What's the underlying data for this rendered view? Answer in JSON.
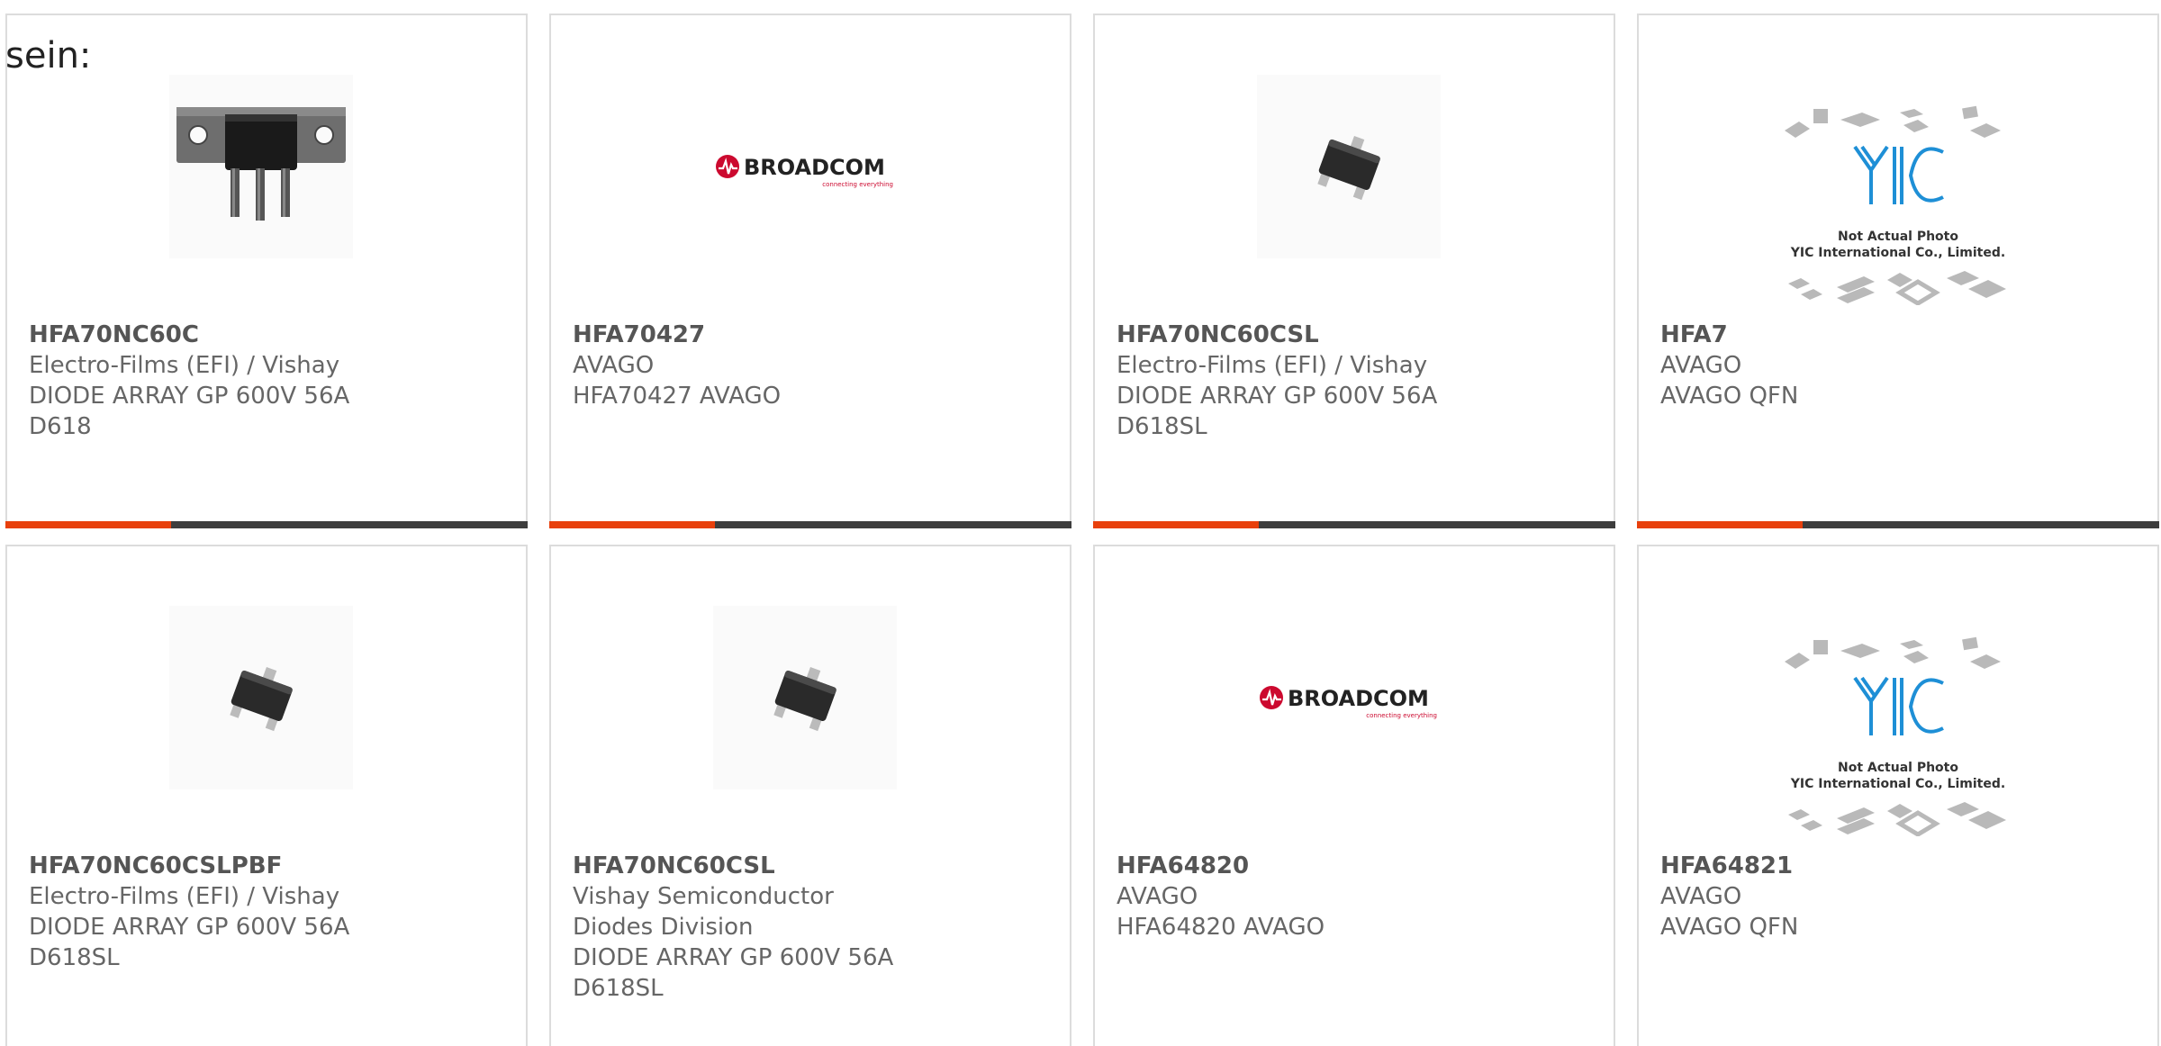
{
  "intro_text": "sein:",
  "colors": {
    "accent": "#e8400c",
    "bar": "#3d3d3d",
    "card_border": "#dcdcdc",
    "broadcom_red": "#cc092f",
    "yic_blue": "#1e8fd6"
  },
  "products": [
    {
      "part_number": "HFA70NC60C",
      "manufacturer": "Electro-Films (EFI) / Vishay",
      "description": "DIODE ARRAY GP 600V 56A D618",
      "image": "d618-package-icon"
    },
    {
      "part_number": "HFA70427",
      "manufacturer": "AVAGO",
      "description": "HFA70427 AVAGO",
      "image": "broadcom-logo"
    },
    {
      "part_number": "HFA70NC60CSL",
      "manufacturer": "Electro-Films (EFI) / Vishay",
      "description": "DIODE ARRAY GP 600V 56A D618SL",
      "image": "sot-package-icon"
    },
    {
      "part_number": "HFA7",
      "manufacturer": "AVAGO",
      "description": "AVAGO QFN",
      "image": "yic-placeholder"
    },
    {
      "part_number": "HFA70NC60CSLPBF",
      "manufacturer": "Electro-Films (EFI) / Vishay",
      "description": "DIODE ARRAY GP 600V 56A D618SL",
      "image": "sot-package-icon"
    },
    {
      "part_number": "HFA70NC60CSL",
      "manufacturer": "Vishay Semiconductor Diodes Division",
      "description": "DIODE ARRAY GP 600V 56A D618SL",
      "image": "sot-package-icon"
    },
    {
      "part_number": "HFA64820",
      "manufacturer": "AVAGO",
      "description": "HFA64820 AVAGO",
      "image": "broadcom-logo"
    },
    {
      "part_number": "HFA64821",
      "manufacturer": "AVAGO",
      "description": "AVAGO QFN",
      "image": "yic-placeholder"
    }
  ],
  "broadcom_logo": {
    "wordmark": "BROADCOM",
    "tagline": "connecting everything"
  },
  "yic_placeholder": {
    "logo_text": "YIC",
    "line1": "Not Actual Photo",
    "line2": "YIC International Co., Limited."
  }
}
